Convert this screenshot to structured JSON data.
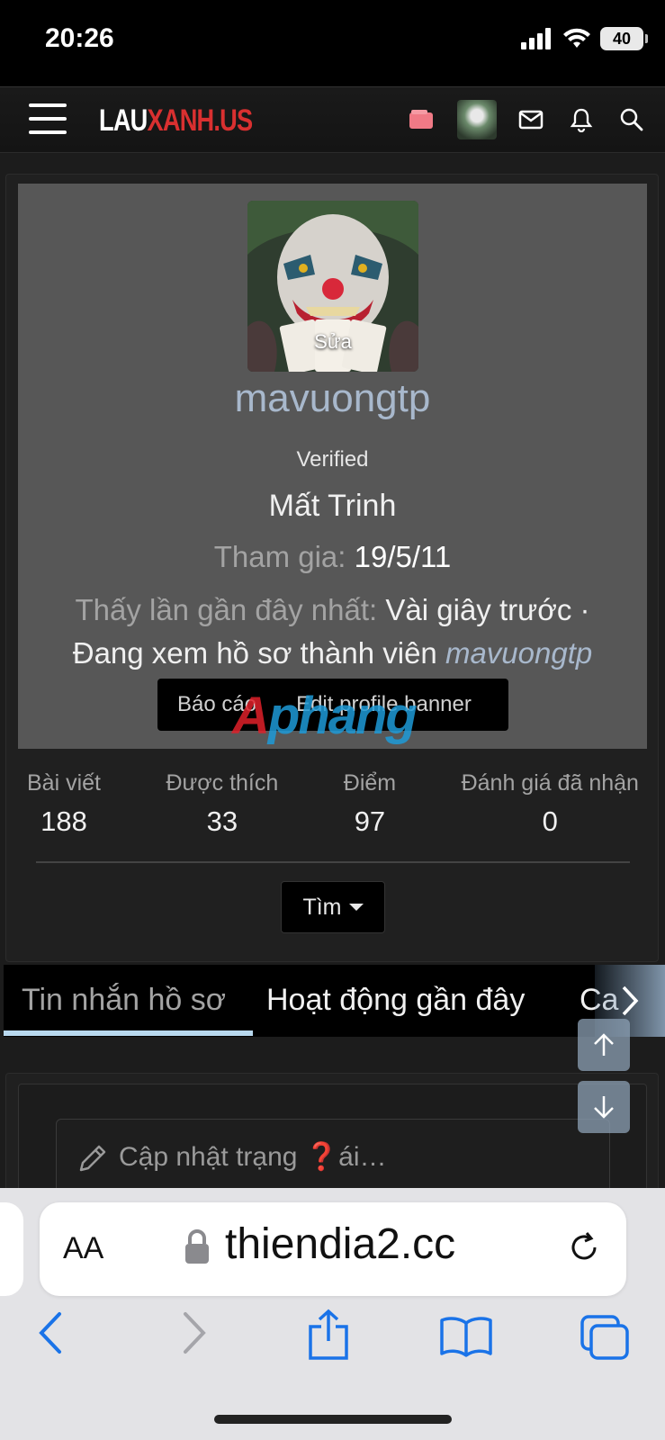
{
  "status_bar": {
    "time": "20:26",
    "battery": "40"
  },
  "header": {
    "logo_part1": "LAU",
    "logo_part2": "XANH.US"
  },
  "profile": {
    "avatar_edit": "Sửa",
    "username": "mavuongtp",
    "verified": "Verified",
    "rank": "Mất Trinh",
    "joined_label": "Tham gia:",
    "joined_value": "19/5/11",
    "lastseen_label": "Thấy lần gần đây nhất:",
    "lastseen_value": "Vài giây trước ·",
    "activity_text": "Đang xem hồ sơ thành viên",
    "activity_link": "mavuongtp",
    "report_label": "Báo cáo",
    "edit_banner_label": "Edit profile banner"
  },
  "watermark": {
    "part1": "A",
    "part2": "phang"
  },
  "stats": [
    {
      "label": "Bài viết",
      "value": "188"
    },
    {
      "label": "Được thích",
      "value": "33"
    },
    {
      "label": "Điểm",
      "value": "97"
    },
    {
      "label": "Đánh giá đã nhận",
      "value": "0"
    }
  ],
  "find_label": "Tìm",
  "tabs": [
    {
      "label": "Tin nhắn hồ sơ",
      "active": true
    },
    {
      "label": "Hoạt động gần đây",
      "active": false
    },
    {
      "label": "Ca",
      "active": false
    }
  ],
  "status_update": {
    "placeholder": "Cập nhật trạng ❓ái…"
  },
  "safari": {
    "aa": "AA",
    "url": "thiendia2.cc"
  },
  "colors": {
    "accent": "#a8b8cc",
    "logo_red": "#d93030",
    "safari_blue": "#1a73e8"
  }
}
